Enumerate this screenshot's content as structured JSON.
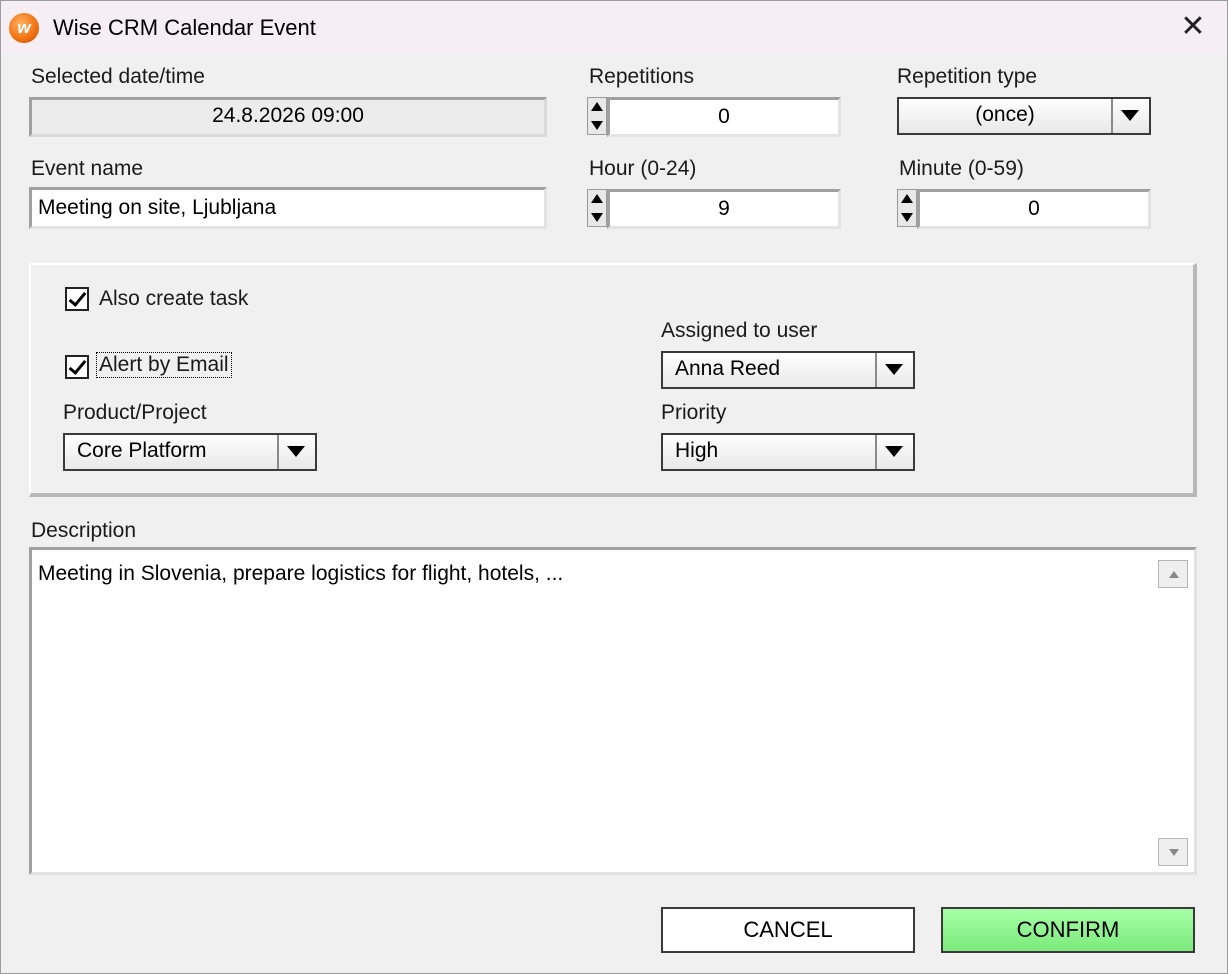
{
  "window": {
    "title": "Wise CRM Calendar Event",
    "app_icon_letter": "w",
    "close_glyph": "✕"
  },
  "fields": {
    "selected_datetime": {
      "label": "Selected date/time",
      "value": "24.8.2026 09:00"
    },
    "repetitions": {
      "label": "Repetitions",
      "value": "0"
    },
    "repetition_type": {
      "label": "Repetition type",
      "value": "(once)"
    },
    "event_name": {
      "label": "Event name",
      "value": "Meeting on site, Ljubljana"
    },
    "hour": {
      "label": "Hour (0-24)",
      "value": "9"
    },
    "minute": {
      "label": "Minute (0-59)",
      "value": "0"
    }
  },
  "task_panel": {
    "also_create_task": {
      "label": "Also create task",
      "checked": true
    },
    "alert_by_email": {
      "label": "Alert by Email",
      "checked": true
    },
    "assigned_to_user": {
      "label": "Assigned to user",
      "value": "Anna Reed"
    },
    "product_project": {
      "label": "Product/Project",
      "value": "Core Platform"
    },
    "priority": {
      "label": "Priority",
      "value": "High"
    }
  },
  "description": {
    "label": "Description",
    "value": "Meeting in Slovenia, prepare logistics for flight, hotels, ..."
  },
  "buttons": {
    "cancel": "CANCEL",
    "confirm": "CONFIRM"
  },
  "colors": {
    "confirm_bg": "#8cf58c",
    "title_bar_bg": "#f5eef2",
    "app_icon": "#f07010"
  }
}
